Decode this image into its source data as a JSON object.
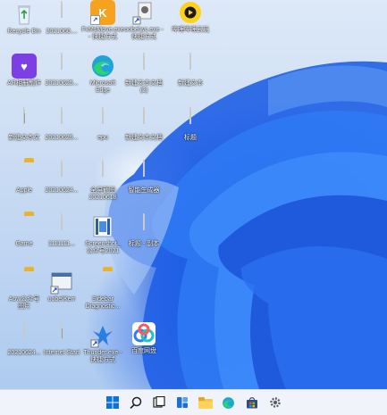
{
  "desktop": {
    "icons": [
      {
        "label": "Recycle Bin"
      },
      {
        "label": "2021060...."
      },
      {
        "label": "FxMsMove.exe\n- 快捷方式"
      },
      {
        "label": "oobe\\wc.exe -\n快捷方式"
      },
      {
        "label": "哔哩哔哩云玩"
      },
      {
        "label": "AR相册制作"
      },
      {
        "label": "20210625..."
      },
      {
        "label": "Microsoft\nEdge"
      },
      {
        "label": "新建文本文档\n(2)"
      },
      {
        "label": "新建文本"
      },
      {
        "label": "新建文本文"
      },
      {
        "label": "20210625..."
      },
      {
        "label": "epu"
      },
      {
        "label": "新建文本文档"
      },
      {
        "label": "标题"
      },
      {
        "label": "Apple"
      },
      {
        "label": "20210624..."
      },
      {
        "label": "全屏截图\n20210618"
      },
      {
        "label": "智能生成器"
      },
      {
        "label": "Game"
      },
      {
        "label": "1111111..."
      },
      {
        "label": "Screenshot_\n公众号2021"
      },
      {
        "label": "标题 - 副本"
      },
      {
        "label": "Aow公众号\n图片"
      },
      {
        "label": "oobe\\Kerr"
      },
      {
        "label": "Sidebar\nDiagnostic..."
      },
      {
        "label": "20210624..."
      },
      {
        "label": "Internet Start"
      },
      {
        "label": "Thunder.exe -\n快捷方式"
      },
      {
        "label": "百度网盘"
      }
    ]
  },
  "taskbar": {
    "items": [
      "windows-start",
      "search",
      "file-explorer",
      "widgets",
      "folder",
      "edge",
      "store",
      "settings"
    ]
  }
}
